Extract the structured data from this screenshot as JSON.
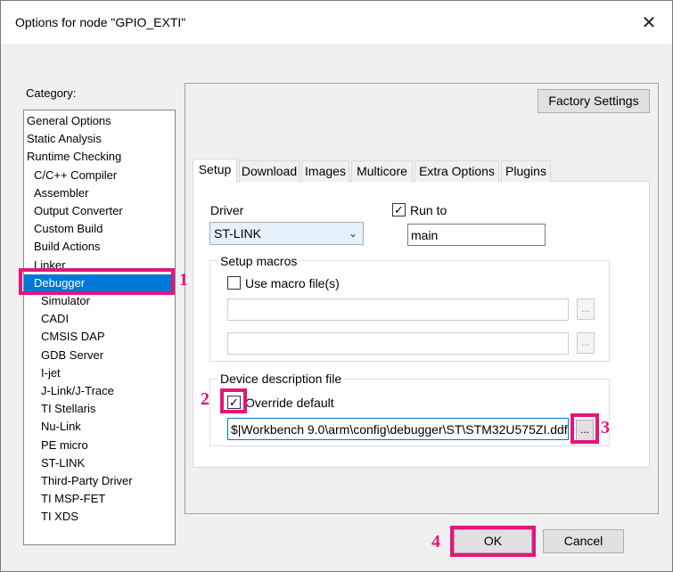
{
  "window": {
    "title": "Options for node \"GPIO_EXTI\"",
    "close_glyph": "✕"
  },
  "category": {
    "label": "Category:",
    "items": [
      {
        "label": "General Options",
        "indent": 0
      },
      {
        "label": "Static Analysis",
        "indent": 0
      },
      {
        "label": "Runtime Checking",
        "indent": 0
      },
      {
        "label": "C/C++ Compiler",
        "indent": 1
      },
      {
        "label": "Assembler",
        "indent": 1
      },
      {
        "label": "Output Converter",
        "indent": 1
      },
      {
        "label": "Custom Build",
        "indent": 1
      },
      {
        "label": "Build Actions",
        "indent": 1
      },
      {
        "label": "Linker",
        "indent": 1
      },
      {
        "label": "Debugger",
        "indent": 1,
        "selected": true
      },
      {
        "label": "Simulator",
        "indent": 2
      },
      {
        "label": "CADI",
        "indent": 2
      },
      {
        "label": "CMSIS DAP",
        "indent": 2
      },
      {
        "label": "GDB Server",
        "indent": 2
      },
      {
        "label": "I-jet",
        "indent": 2
      },
      {
        "label": "J-Link/J-Trace",
        "indent": 2
      },
      {
        "label": "TI Stellaris",
        "indent": 2
      },
      {
        "label": "Nu-Link",
        "indent": 2
      },
      {
        "label": "PE micro",
        "indent": 2
      },
      {
        "label": "ST-LINK",
        "indent": 2
      },
      {
        "label": "Third-Party Driver",
        "indent": 2
      },
      {
        "label": "TI MSP-FET",
        "indent": 2
      },
      {
        "label": "TI XDS",
        "indent": 2
      }
    ]
  },
  "factory_settings_label": "Factory Settings",
  "tabs": [
    "Setup",
    "Download",
    "Images",
    "Multicore",
    "Extra Options",
    "Plugins"
  ],
  "active_tab": "Setup",
  "setup": {
    "driver_label": "Driver",
    "driver_value": "ST-LINK",
    "run_to_label": "Run to",
    "run_to_checked": true,
    "run_to_value": "main",
    "setup_macros_title": "Setup macros",
    "use_macro_label": "Use macro file(s)",
    "use_macro_checked": false,
    "macro_field_1": "",
    "macro_field_2": "",
    "browse_label": "...",
    "device_desc_title": "Device description file",
    "override_label": "Override default",
    "override_checked": true,
    "device_file_value": "$|Workbench 9.0\\arm\\config\\debugger\\ST\\STM32U575ZI.ddf"
  },
  "callouts": [
    "1",
    "2",
    "3",
    "4"
  ],
  "footer": {
    "ok_label": "OK",
    "cancel_label": "Cancel"
  },
  "colors": {
    "highlight": "#e5147c",
    "selection": "#0078d7"
  }
}
